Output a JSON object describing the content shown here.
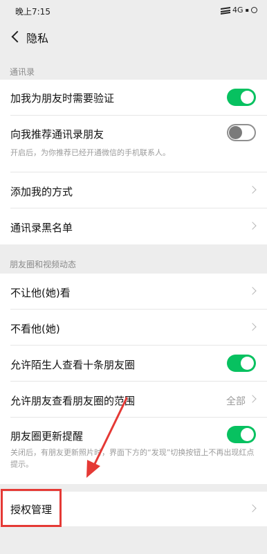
{
  "status_bar": {
    "time": "晚上7:15",
    "network": "4G"
  },
  "nav": {
    "title": "隐私"
  },
  "sections": {
    "contacts_header": "通讯录",
    "moments_header": "朋友圈和视频动态"
  },
  "rows": {
    "verify_on_add": {
      "label": "加我为朋友时需要验证",
      "toggle": "on"
    },
    "recommend_contacts": {
      "label": "向我推荐通讯录朋友",
      "desc": "开启后，为你推荐已经开通微信的手机联系人。",
      "toggle": "off"
    },
    "add_methods": {
      "label": "添加我的方式"
    },
    "blacklist": {
      "label": "通讯录黑名单"
    },
    "hide_from": {
      "label": "不让他(她)看"
    },
    "dont_see": {
      "label": "不看他(她)"
    },
    "stranger_ten": {
      "label": "允许陌生人查看十条朋友圈",
      "toggle": "on"
    },
    "visible_range": {
      "label": "允许朋友查看朋友圈的范围",
      "value": "全部"
    },
    "moments_reminder": {
      "label": "朋友圈更新提醒",
      "desc": "关闭后，有朋友更新照片时，界面下方的“发现”切换按钮上不再出现红点提示。",
      "toggle": "on"
    },
    "authorization": {
      "label": "授权管理"
    }
  },
  "colors": {
    "toggle_on": "#07c160",
    "highlight": "#e53935"
  }
}
